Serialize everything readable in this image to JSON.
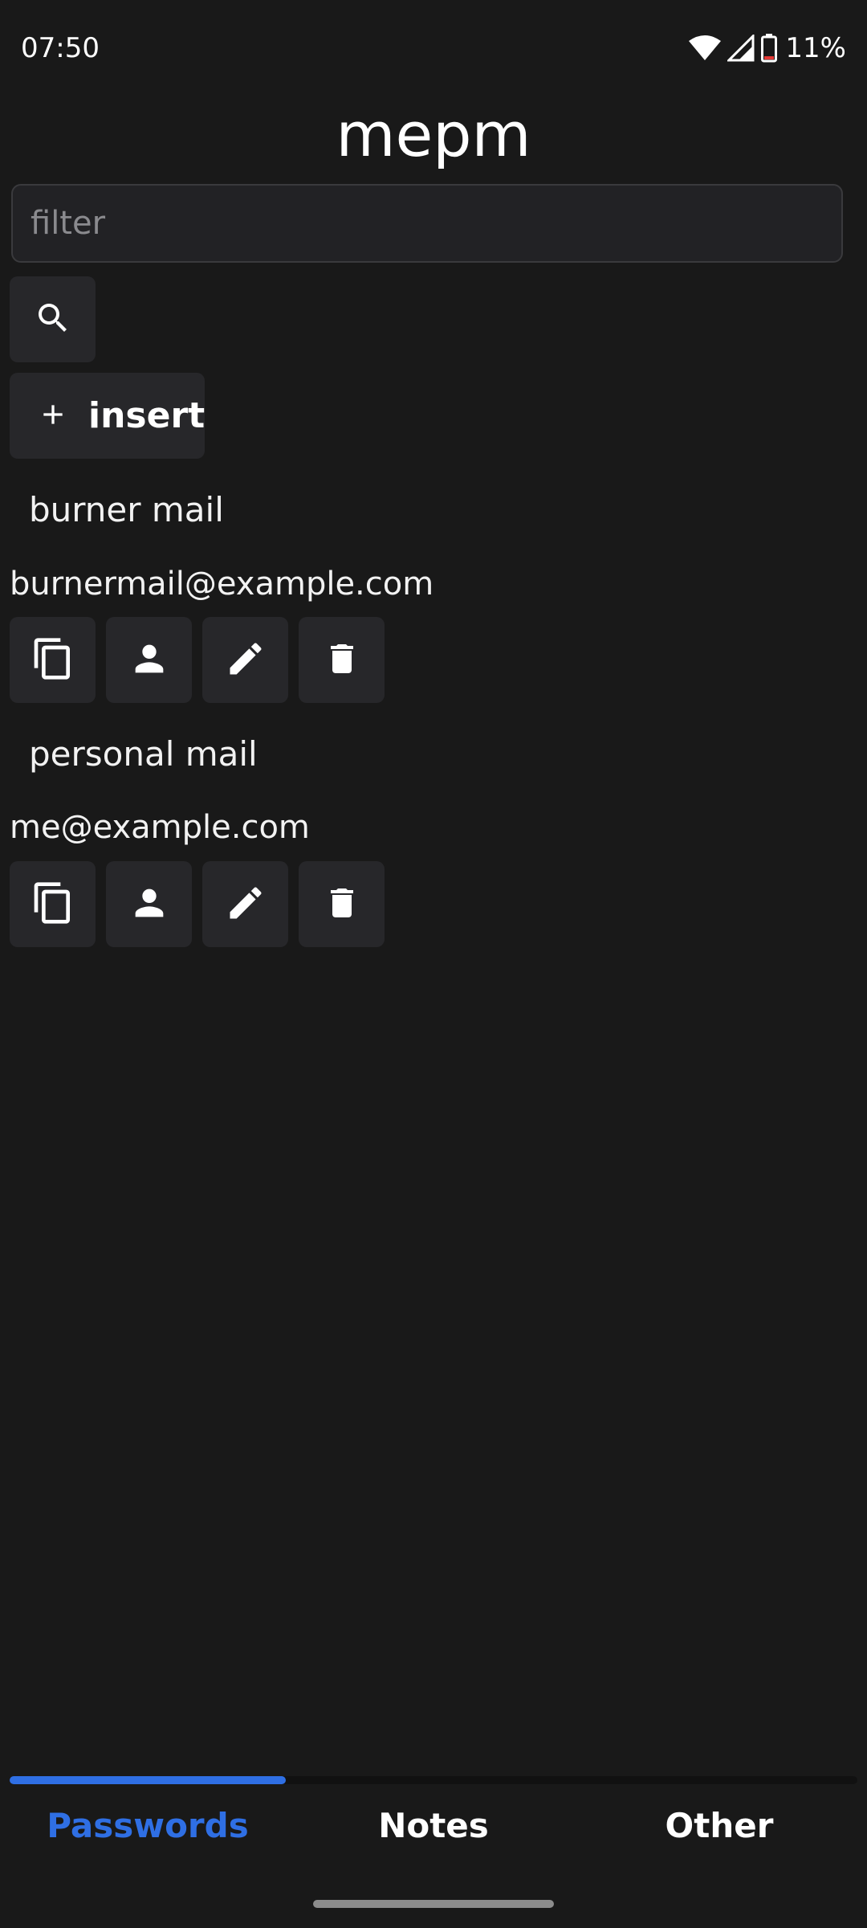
{
  "status_bar": {
    "time": "07:50",
    "battery": "11%"
  },
  "app": {
    "title": "mepm"
  },
  "search": {
    "placeholder": "filter",
    "value": ""
  },
  "toolbar": {
    "insert_label": "insert"
  },
  "entries": [
    {
      "name": "burner mail",
      "username": "burnermail@example.com"
    },
    {
      "name": "personal mail",
      "username": "me@example.com"
    }
  ],
  "tabs": [
    {
      "label": "Passwords",
      "active": true
    },
    {
      "label": "Notes",
      "active": false
    },
    {
      "label": "Other",
      "active": false
    }
  ],
  "colors": {
    "accent": "#2f6fe4",
    "background": "#191919",
    "button": "#27272a"
  },
  "icons": [
    "search-icon",
    "plus-icon",
    "copy-icon",
    "person-icon",
    "pencil-icon",
    "trash-icon",
    "wifi-icon",
    "signal-icon",
    "battery-icon"
  ]
}
